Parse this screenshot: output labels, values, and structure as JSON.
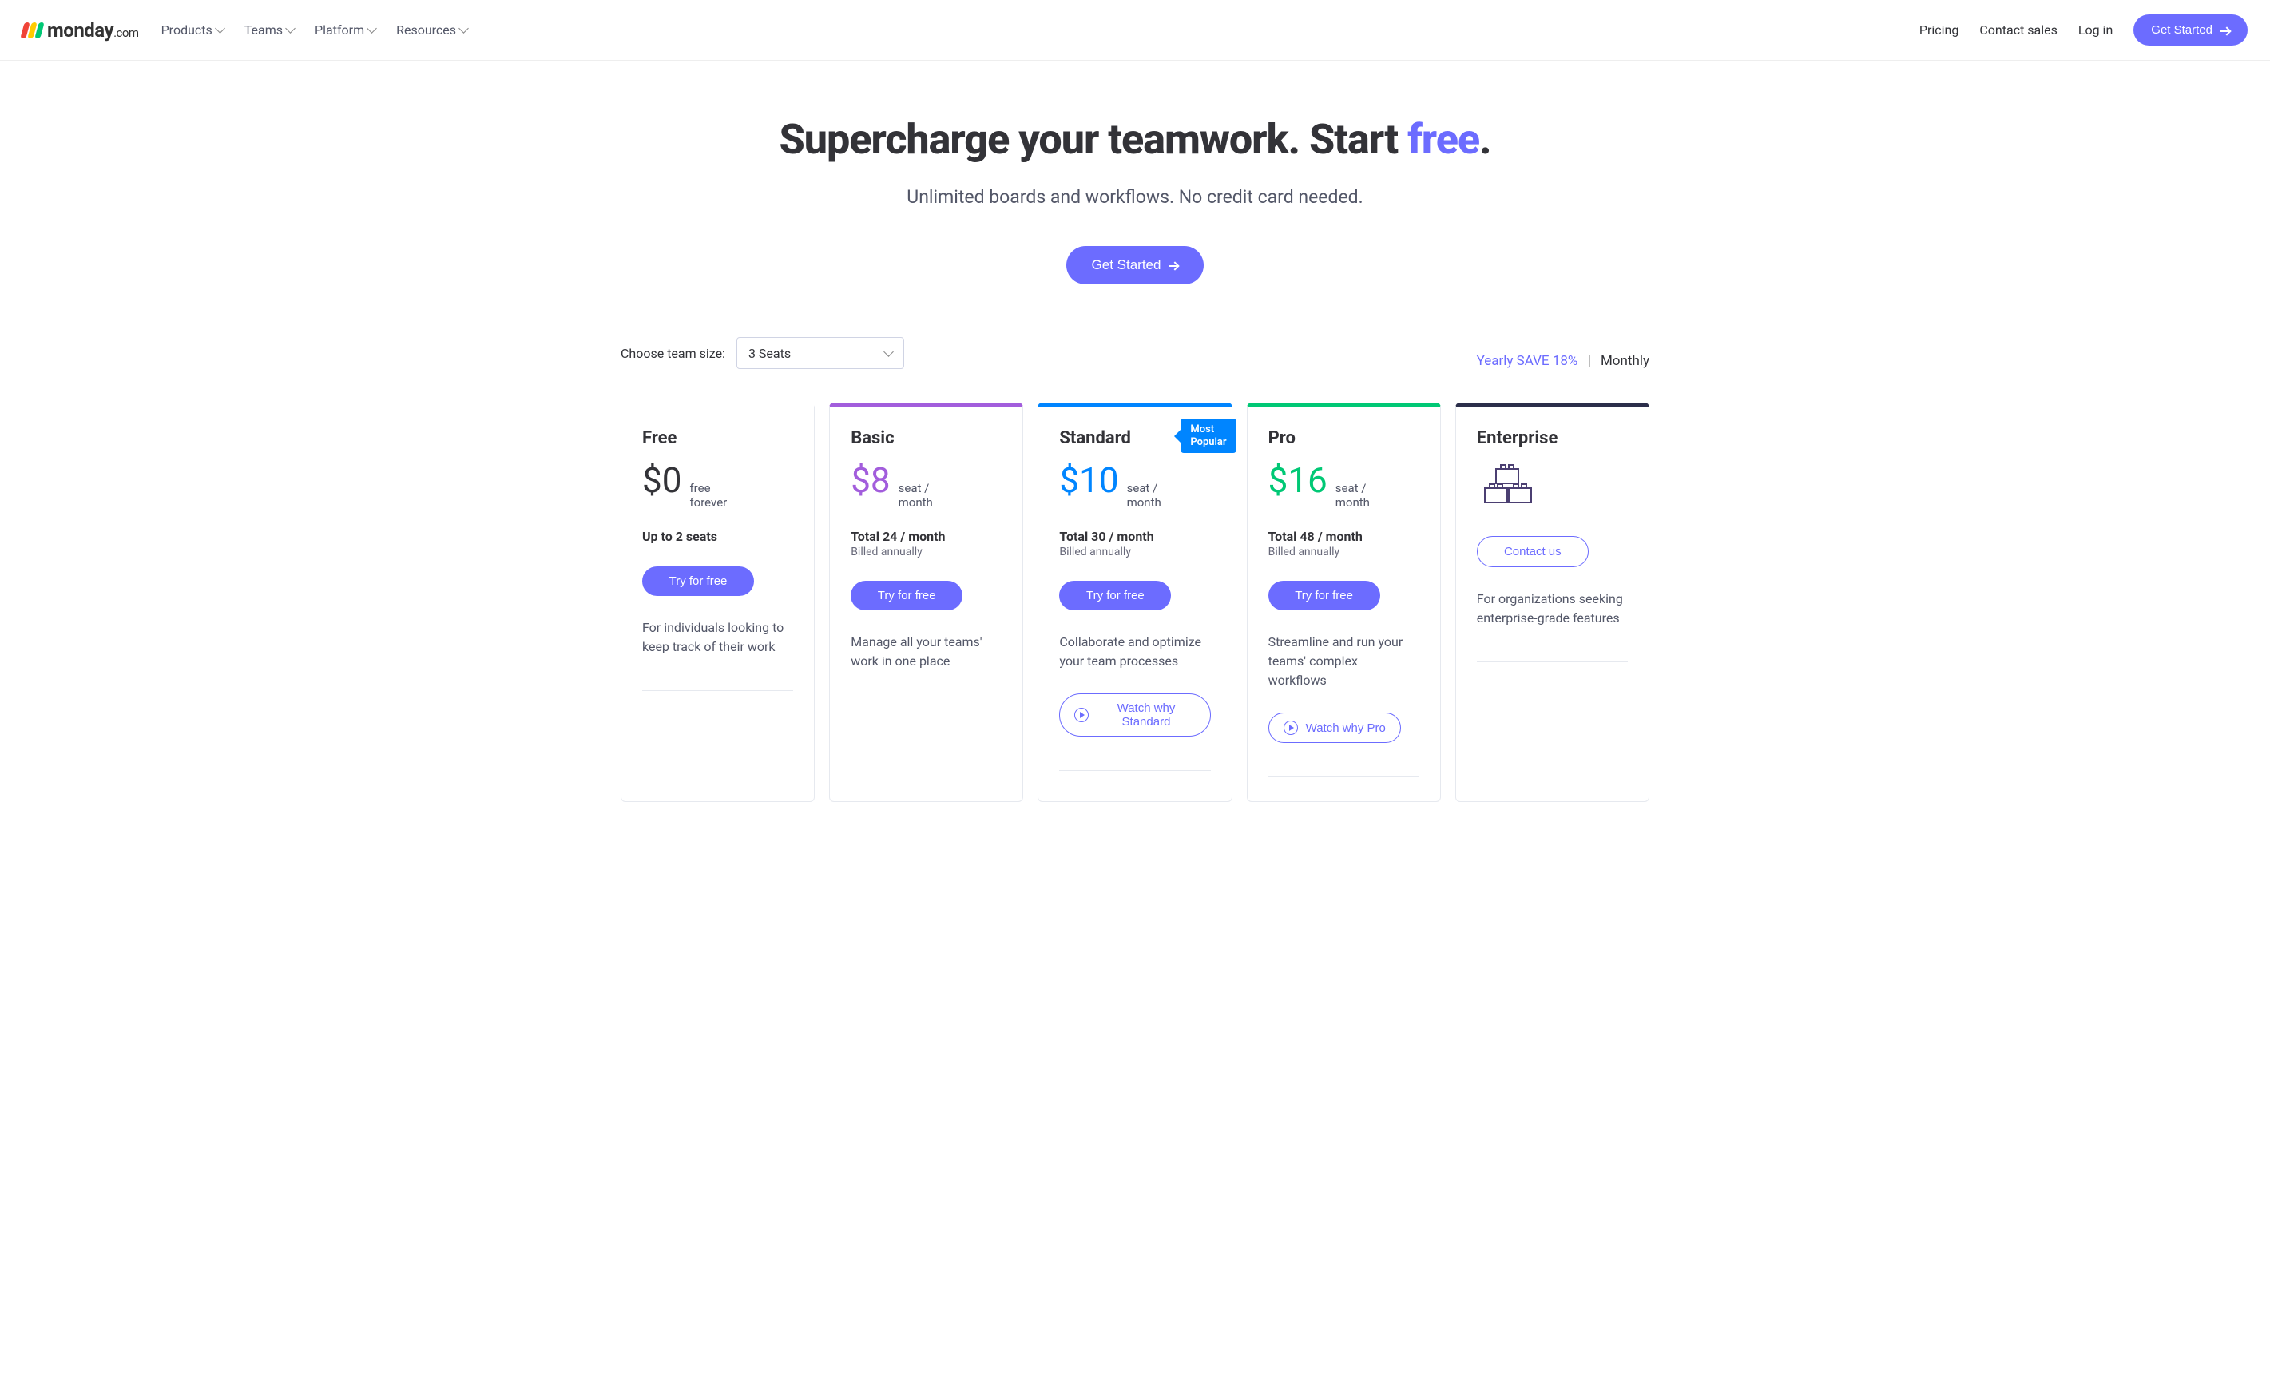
{
  "header": {
    "brand_main": "monday",
    "brand_suffix": ".com",
    "nav": [
      "Products",
      "Teams",
      "Platform",
      "Resources"
    ],
    "links": {
      "pricing": "Pricing",
      "contact": "Contact sales",
      "login": "Log in"
    },
    "cta": "Get Started"
  },
  "hero": {
    "title_pre": "Supercharge your teamwork. Start ",
    "title_accent": "free",
    "title_post": ".",
    "subtitle": "Unlimited boards and workflows. No credit card needed.",
    "cta": "Get Started"
  },
  "controls": {
    "size_label": "Choose team size:",
    "size_value": "3 Seats",
    "billing_yearly": "Yearly SAVE 18%",
    "billing_monthly": "Monthly"
  },
  "plans": [
    {
      "key": "free",
      "name": "Free",
      "price": "$0",
      "price_unit": "free\nforever",
      "seats": "Up to 2 seats",
      "cta": "Try for free",
      "desc": "For individuals looking to keep track of their work"
    },
    {
      "key": "basic",
      "name": "Basic",
      "price": "$8",
      "price_unit": "seat /\nmonth",
      "total": "Total 24 / month",
      "billing": "Billed annually",
      "cta": "Try for free",
      "desc": "Manage all your teams' work in one place"
    },
    {
      "key": "standard",
      "name": "Standard",
      "badge": "Most\nPopular",
      "price": "$10",
      "price_unit": "seat /\nmonth",
      "total": "Total 30 / month",
      "billing": "Billed annually",
      "cta": "Try for free",
      "desc": "Collaborate and optimize your team processes",
      "watch": "Watch why Standard"
    },
    {
      "key": "pro",
      "name": "Pro",
      "price": "$16",
      "price_unit": "seat /\nmonth",
      "total": "Total 48 / month",
      "billing": "Billed annually",
      "cta": "Try for free",
      "desc": "Streamline and run your teams' complex workflows",
      "watch": "Watch why Pro"
    },
    {
      "key": "enterprise",
      "name": "Enterprise",
      "cta": "Contact us",
      "desc": "For organizations seeking enterprise-grade features"
    }
  ]
}
